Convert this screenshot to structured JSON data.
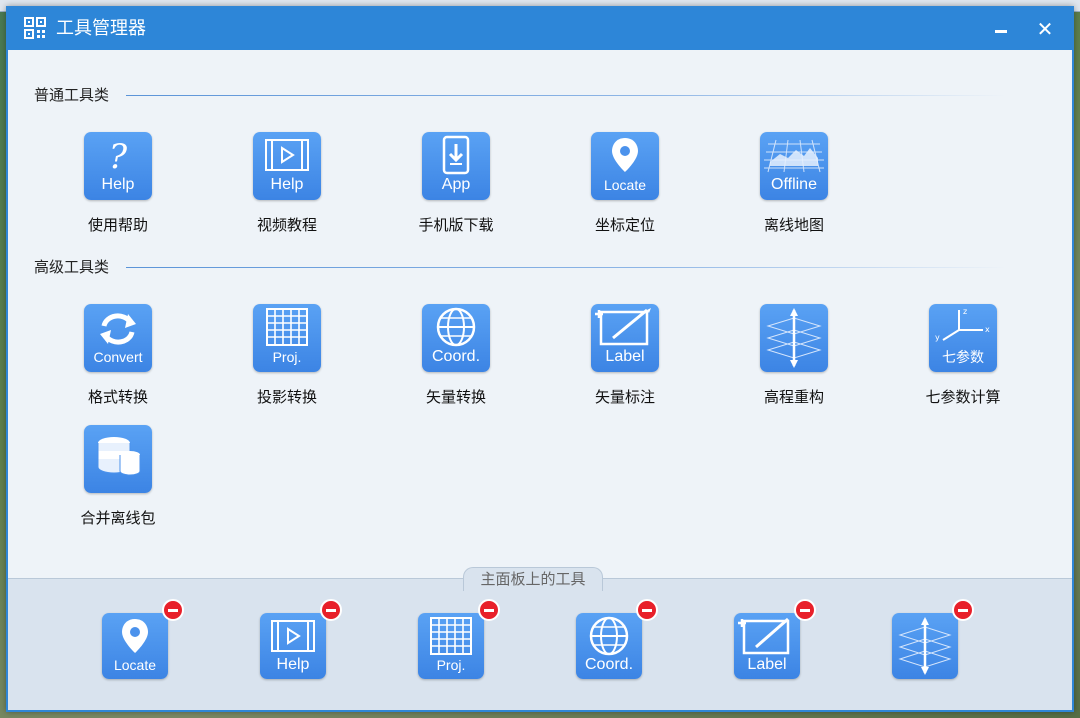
{
  "window": {
    "title": "工具管理器"
  },
  "sections": {
    "general": {
      "title": "普通工具类",
      "tools": [
        {
          "label": "使用帮助",
          "caption": "Help",
          "icon": "question-icon"
        },
        {
          "label": "视频教程",
          "caption": "Help",
          "icon": "video-icon"
        },
        {
          "label": "手机版下载",
          "caption": "App",
          "icon": "phone-download-icon"
        },
        {
          "label": "坐标定位",
          "caption": "Locate",
          "icon": "location-pin-icon"
        },
        {
          "label": "离线地图",
          "caption": "Offline",
          "icon": "offline-map-icon"
        }
      ]
    },
    "advanced": {
      "title": "高级工具类",
      "tools": [
        {
          "label": "格式转换",
          "caption": "Convert",
          "icon": "convert-icon"
        },
        {
          "label": "投影转换",
          "caption": "Proj.",
          "icon": "grid-icon"
        },
        {
          "label": "矢量转换",
          "caption": "Coord.",
          "icon": "globe-icon"
        },
        {
          "label": "矢量标注",
          "caption": "Label",
          "icon": "label-icon"
        },
        {
          "label": "高程重构",
          "caption": "",
          "icon": "elevation-icon"
        },
        {
          "label": "七参数计算",
          "caption": "七参数",
          "icon": "axes-icon"
        },
        {
          "label": "合并离线包",
          "caption": "",
          "icon": "database-icon"
        }
      ]
    }
  },
  "panel": {
    "title": "主面板上的工具",
    "tools": [
      {
        "caption": "Locate",
        "icon": "location-pin-icon"
      },
      {
        "caption": "Help",
        "icon": "video-icon"
      },
      {
        "caption": "Proj.",
        "icon": "grid-icon"
      },
      {
        "caption": "Coord.",
        "icon": "globe-icon"
      },
      {
        "caption": "Label",
        "icon": "label-icon"
      },
      {
        "caption": "",
        "icon": "elevation-icon"
      }
    ]
  },
  "colors": {
    "titlebar": "#2d86d8",
    "icon_blue": "#3c84e4",
    "remove_red": "#e8202a"
  }
}
